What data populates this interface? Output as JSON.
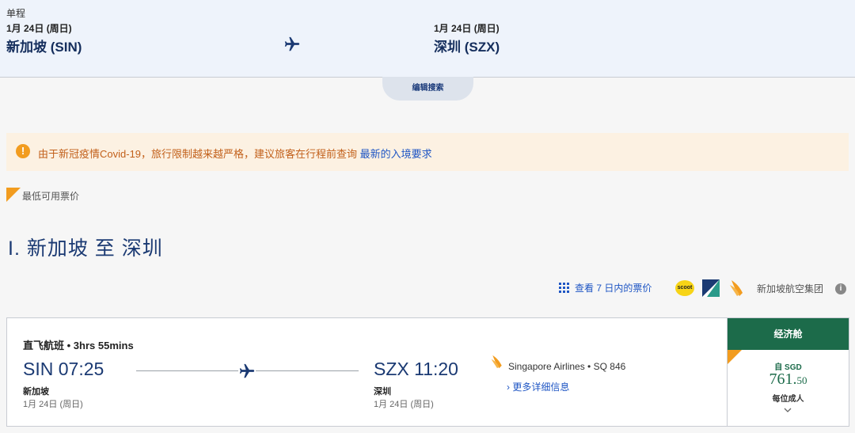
{
  "search": {
    "trip_type": "单程",
    "origin": {
      "date": "1月 24日 (周日)",
      "city": "新加坡 (SIN)"
    },
    "destination": {
      "date": "1月 24日 (周日)",
      "city": "深圳 (SZX)"
    },
    "edit_label": "编辑搜索"
  },
  "notice": {
    "icon": "!",
    "text": "由于新冠疫情Covid-19，旅行限制越来越严格，建议旅客在行程前查询 ",
    "link": "最新的入境要求"
  },
  "lowest_fare_label": "最低可用票价",
  "route_title": "I. 新加坡 至 深圳",
  "toolbar": {
    "week_link": "查看 7 日内的票价",
    "scoot_logo": "scoot",
    "group_label": "新加坡航空集团",
    "info_icon": "i"
  },
  "flight": {
    "type_label": "直飞航班",
    "separator": " • ",
    "duration": "3hrs 55mins",
    "departure": {
      "time": "SIN 07:25",
      "city": "新加坡",
      "date": "1月 24日 (周日)"
    },
    "arrival": {
      "time": "SZX 11:20",
      "city": "深圳",
      "date": "1月 24日 (周日)"
    },
    "airline": "Singapore Airlines • SQ 846",
    "details_link": "› 更多详细信息"
  },
  "fare": {
    "cabin": "经济舱",
    "from_label": "自 SGD",
    "price_main": "761.",
    "price_cents": "50",
    "per_label": "每位成人"
  },
  "colors": {
    "brand_navy": "#1b3a73",
    "link_blue": "#1f56c4",
    "accent_orange": "#f29c1f",
    "cabin_green": "#1c6b4a"
  }
}
